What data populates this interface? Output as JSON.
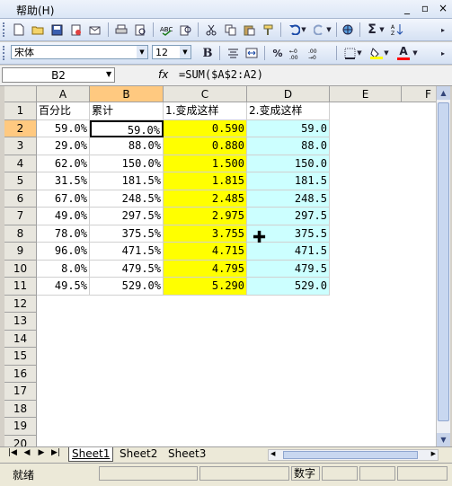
{
  "menu": {
    "help_label": "帮助(H)"
  },
  "window_controls": {
    "min": "_",
    "restore": "▫",
    "close": "×"
  },
  "toolbar": {
    "font_name": "宋体",
    "font_size": "12",
    "bold_label": "B",
    "percent_label": "%",
    "sum_label": "Σ",
    "fontcolor_label": "A",
    "fill_color": "#ffff00",
    "font_color": "#ff0000"
  },
  "formula_bar": {
    "name_box": "B2",
    "fx_label": "fx",
    "formula": "=SUM($A$2:A2)"
  },
  "sheet": {
    "columns": [
      "A",
      "B",
      "C",
      "D",
      "E",
      "F"
    ],
    "selected_column": "B",
    "rows": [
      "1",
      "2",
      "3",
      "4",
      "5",
      "6",
      "7",
      "8",
      "9",
      "10",
      "11",
      "12",
      "13",
      "14",
      "15",
      "16",
      "17",
      "18",
      "19",
      "20"
    ],
    "selected_row": "2",
    "headers": {
      "a": "百分比",
      "b": "累计",
      "c": "1.变成这样",
      "d": "2.变成这样"
    },
    "col_a": [
      "59.0%",
      "29.0%",
      "62.0%",
      "31.5%",
      "67.0%",
      "49.0%",
      "78.0%",
      "96.0%",
      "8.0%",
      "49.5%"
    ],
    "col_b": [
      "59.0%",
      "88.0%",
      "150.0%",
      "181.5%",
      "248.5%",
      "297.5%",
      "375.5%",
      "471.5%",
      "479.5%",
      "529.0%"
    ],
    "col_c": [
      "0.590",
      "0.880",
      "1.500",
      "1.815",
      "2.485",
      "2.975",
      "3.755",
      "4.715",
      "4.795",
      "5.290"
    ],
    "col_d": [
      "59.0",
      "88.0",
      "150.0",
      "181.5",
      "248.5",
      "297.5",
      "375.5",
      "471.5",
      "479.5",
      "529.0"
    ],
    "col_c_fill": "#ffff00",
    "col_d_fill": "#ccffff"
  },
  "tabs": [
    "Sheet1",
    "Sheet2",
    "Sheet3"
  ],
  "status": {
    "ready": "就绪",
    "num": "数字"
  }
}
